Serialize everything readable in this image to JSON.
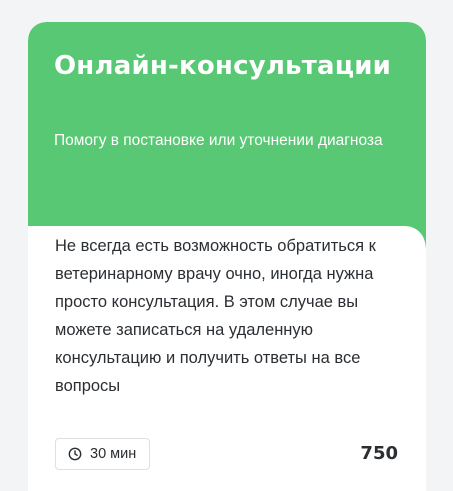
{
  "card": {
    "title": "Онлайн-консультации",
    "subtitle": "Помогу в постановке или уточнении диагноза",
    "description": "Не всегда есть возможность обратиться к ветеринарному врачу очно, иногда нужна просто консультация. В этом случае вы можете записаться на удаленную консультацию и получить ответы на все вопросы",
    "duration": "30 мин",
    "price": "750"
  },
  "icons": {
    "duration": "clock-icon"
  },
  "colors": {
    "header_bg": "#59c874",
    "text": "#2b2f33",
    "badge_border": "#dcdfe3"
  }
}
